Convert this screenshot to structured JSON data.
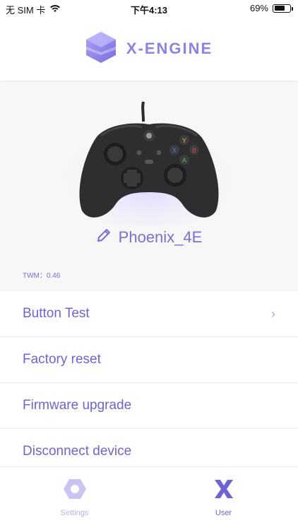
{
  "status_bar": {
    "carrier": "无 SIM 卡",
    "time": "下午4:13",
    "battery_percent": "69%",
    "battery_level": 0.69,
    "wifi_icon": "wifi-icon"
  },
  "header": {
    "brand_name": "X-ENGINE",
    "logo_icon": "hexagon-logo-icon"
  },
  "device": {
    "name": "Phoenix_4E",
    "edit_icon": "pencil-icon",
    "firmware_version": "TWM：0.46"
  },
  "menu": {
    "items": [
      {
        "label": "Button Test",
        "chevron": "›"
      },
      {
        "label": "Factory reset"
      },
      {
        "label": "Firmware upgrade"
      },
      {
        "label": "Disconnect device"
      }
    ]
  },
  "tab_bar": {
    "tabs": [
      {
        "label": "Settings",
        "icon": "hexagon-icon"
      },
      {
        "label": "User",
        "icon": "x-icon"
      }
    ]
  },
  "colors": {
    "accent": "#7a6fd9",
    "accent_light": "#b9b3ee",
    "brand": "#8a83e8"
  }
}
